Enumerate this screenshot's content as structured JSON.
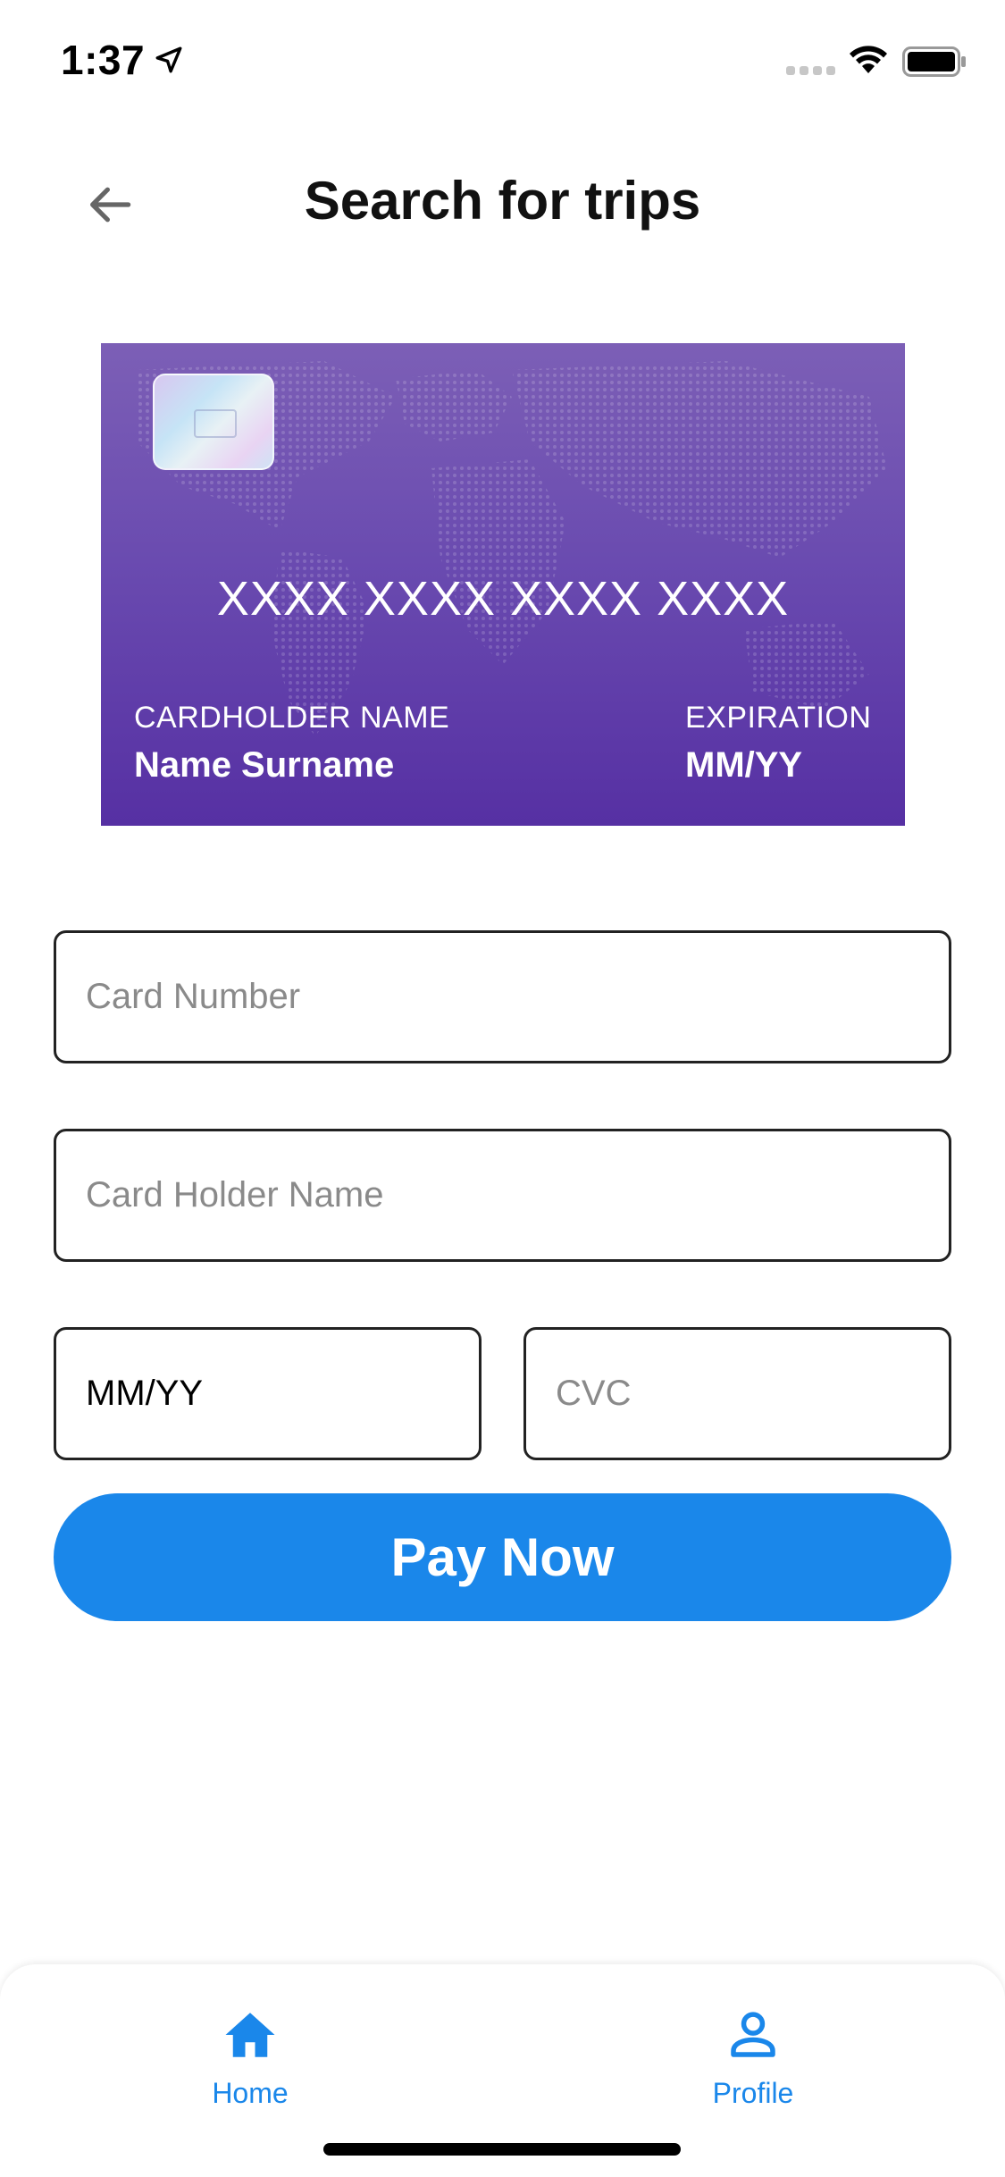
{
  "status_bar": {
    "time": "1:37",
    "icons": [
      "location-arrow-icon",
      "signal-icon",
      "wifi-icon",
      "battery-icon"
    ]
  },
  "header": {
    "title": "Search for trips",
    "back_icon": "arrow-left-icon"
  },
  "card": {
    "number": "XXXX XXXX XXXX XXXX",
    "holder_label": "CARDHOLDER NAME",
    "holder_value": "Name Surname",
    "expiration_label": "EXPIRATION",
    "expiration_value": "MM/YY",
    "gradient_colors": [
      "#7c5fb6",
      "#5630a3"
    ]
  },
  "form": {
    "card_number": {
      "placeholder": "Card Number",
      "value": ""
    },
    "card_holder_name": {
      "placeholder": "Card Holder Name",
      "value": ""
    },
    "expiry": {
      "placeholder": "MM/YY",
      "value": "MM/YY"
    },
    "cvc": {
      "placeholder": "CVC",
      "value": ""
    }
  },
  "pay_button": {
    "label": "Pay Now",
    "color": "#1a87ea"
  },
  "bottom_nav": {
    "items": [
      {
        "label": "Home",
        "icon": "home-icon"
      },
      {
        "label": "Profile",
        "icon": "person-icon"
      }
    ],
    "accent_color": "#1a87ea"
  }
}
